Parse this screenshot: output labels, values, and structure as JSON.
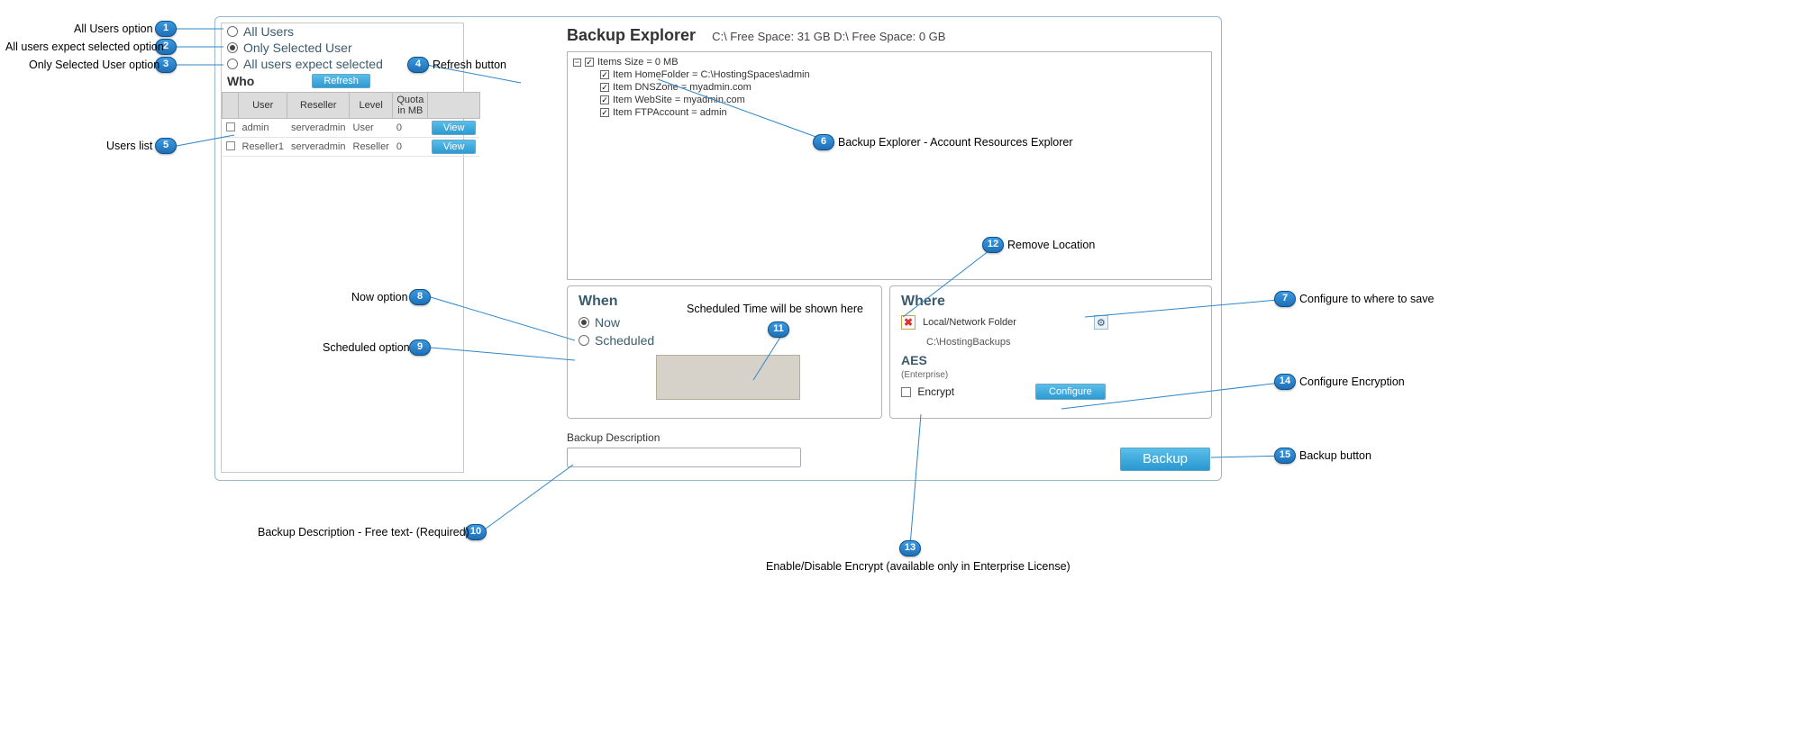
{
  "annotations": {
    "b1": "1",
    "l1": "All Users option",
    "b2": "2",
    "l2": "All users expect selected option",
    "b3": "3",
    "l3": "Only Selected User option",
    "b4": "4",
    "l4": "Refresh button",
    "b5": "5",
    "l5": "Users list",
    "b6": "6",
    "l6": "Backup Explorer - Account Resources Explorer",
    "b7": "7",
    "l7": "Configure to where to save",
    "b8": "8",
    "l8": "Now option",
    "b9": "9",
    "l9": "Scheduled option",
    "b10": "10",
    "l10": "Backup Description - Free text- (Required)",
    "b11": "11",
    "l11": "Scheduled Time will be shown here",
    "b12": "12",
    "l12": "Remove Location",
    "b13": "13",
    "l13": "Enable/Disable Encrypt (available only in Enterprise License)",
    "b14": "14",
    "l14": "Configure Encryption",
    "b15": "15",
    "l15": "Backup button"
  },
  "radios": {
    "all": "All Users",
    "sel": "Only Selected User",
    "exc": "All users expect selected"
  },
  "who": {
    "title": "Who",
    "refresh": "Refresh",
    "cols": {
      "user": "User",
      "reseller": "Reseller",
      "level": "Level",
      "quota": "Quota in MB",
      "view": "View"
    },
    "rows": [
      {
        "user": "admin",
        "reseller": "serveradmin",
        "level": "User",
        "quota": "0"
      },
      {
        "user": "Reseller1",
        "reseller": "serveradmin",
        "level": "Reseller",
        "quota": "0"
      }
    ]
  },
  "header": {
    "title": "Backup Explorer",
    "fs": "C:\\ Free Space: 31 GB  D:\\ Free Space: 0 GB"
  },
  "tree": {
    "root": "Items Size = 0 MB",
    "n1": "Item HomeFolder = C:\\HostingSpaces\\admin",
    "n2": "Item DNSZone = myadmin.com",
    "n3": "Item WebSite = myadmin.com",
    "n4": "Item FTPAccount = admin"
  },
  "when": {
    "title": "When",
    "now": "Now",
    "sched": "Scheduled"
  },
  "where": {
    "title": "Where",
    "loc": "Local/Network Folder",
    "path": "C:\\HostingBackups",
    "aes": "AES",
    "aes_sub": "(Enterprise)",
    "encrypt": "Encrypt",
    "configure": "Configure"
  },
  "desc": {
    "label": "Backup Description"
  },
  "backup": {
    "label": "Backup"
  }
}
